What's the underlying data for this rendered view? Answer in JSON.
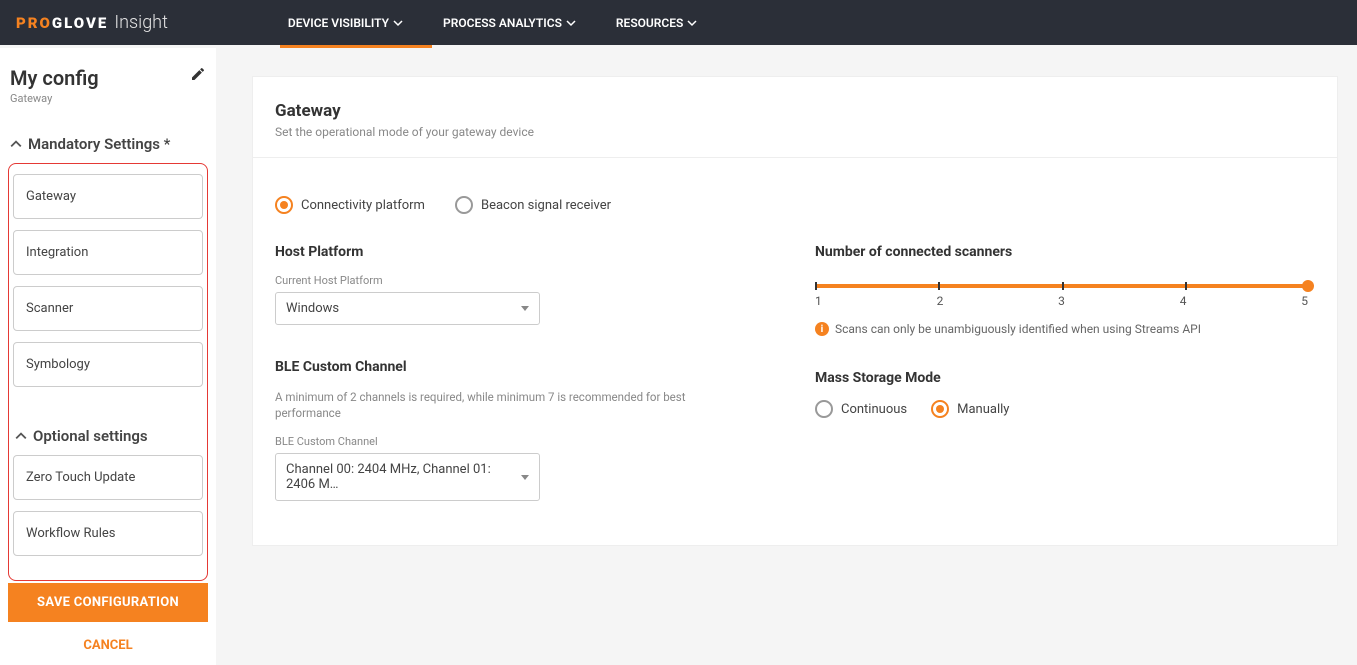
{
  "brand": {
    "pro": "PRO",
    "glove": "GLOVE",
    "insight": "Insight"
  },
  "nav": {
    "items": [
      {
        "label": "DEVICE VISIBILITY"
      },
      {
        "label": "PROCESS ANALYTICS"
      },
      {
        "label": "RESOURCES"
      }
    ]
  },
  "sidebar": {
    "title": "My config",
    "subtitle": "Gateway",
    "sections": {
      "mandatory": {
        "label": "Mandatory Settings *",
        "items": [
          {
            "label": "Gateway"
          },
          {
            "label": "Integration"
          },
          {
            "label": "Scanner"
          },
          {
            "label": "Symbology"
          }
        ]
      },
      "optional": {
        "label": "Optional settings",
        "items": [
          {
            "label": "Zero Touch Update"
          },
          {
            "label": "Workflow Rules"
          }
        ]
      }
    },
    "save": "SAVE CONFIGURATION",
    "cancel": "CANCEL"
  },
  "main": {
    "title": "Gateway",
    "subtitle": "Set the operational mode of your gateway device",
    "mode_radios": {
      "connectivity": "Connectivity platform",
      "beacon": "Beacon signal receiver"
    },
    "host": {
      "heading": "Host Platform",
      "field_label": "Current Host Platform",
      "value": "Windows"
    },
    "ble": {
      "heading": "BLE Custom Channel",
      "subtext": "A minimum of 2 channels is required, while minimum 7 is recommended for best performance",
      "field_label": "BLE Custom Channel",
      "value": "Channel 00: 2404 MHz, Channel 01: 2406 M…"
    },
    "scanners": {
      "heading": "Number of connected scanners",
      "ticks": [
        "1",
        "2",
        "3",
        "4",
        "5"
      ],
      "info": "Scans can only be unambiguously identified when using Streams API"
    },
    "mass_storage": {
      "heading": "Mass Storage Mode",
      "continuous": "Continuous",
      "manually": "Manually"
    }
  }
}
